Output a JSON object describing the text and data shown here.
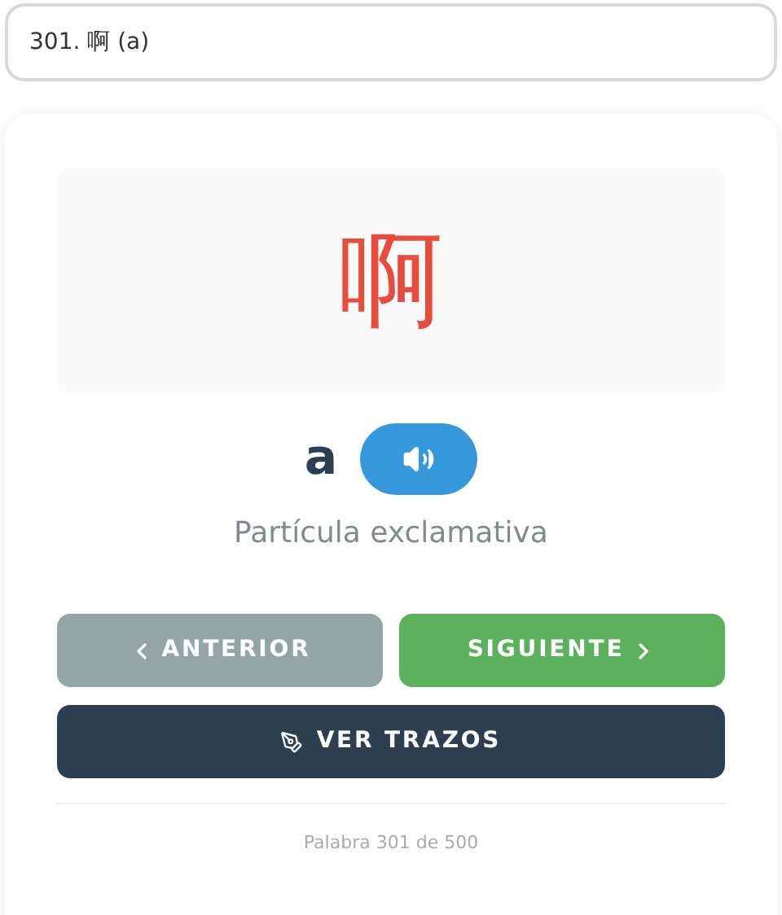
{
  "word_select": {
    "value": "301. 啊 (a)"
  },
  "card": {
    "hanzi": "啊",
    "pinyin": "a",
    "meaning": "Partícula exclamativa",
    "buttons": [
      {
        "kind": "prev",
        "label": "ANTERIOR"
      },
      {
        "kind": "next",
        "label": "SIGUIENTE"
      },
      {
        "kind": "strokes",
        "label": "VER TRAZOS"
      }
    ],
    "footer": "Palabra 301 de 500"
  }
}
